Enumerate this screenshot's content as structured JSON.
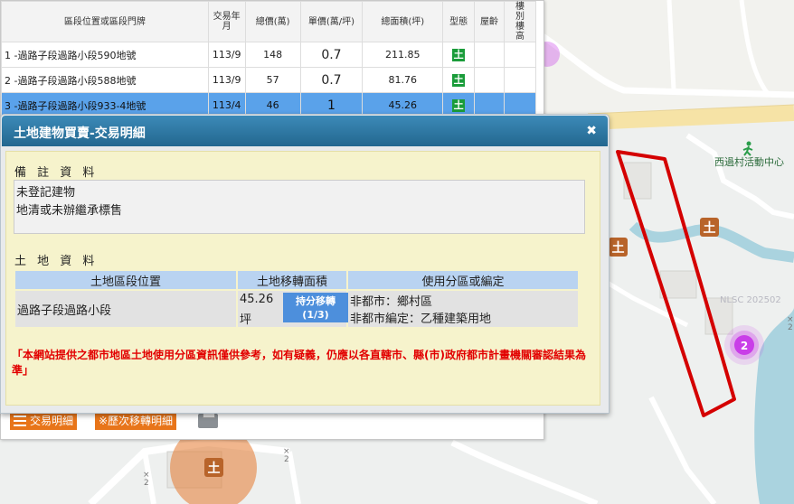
{
  "results": {
    "headers": [
      "區段位置或區段門牌",
      "交易年月",
      "總價(萬)",
      "單價(萬/坪)",
      "總面積(坪)",
      "型態",
      "屋齡",
      "樓別樓高"
    ],
    "rows": [
      {
        "address": "1 -過路子段過路小段590地號",
        "date": "113/9",
        "total": "148",
        "unit": "0.7",
        "area": "211.85",
        "type": "土",
        "age": "",
        "floor": ""
      },
      {
        "address": "2 -過路子段過路小段588地號",
        "date": "113/9",
        "total": "57",
        "unit": "0.7",
        "area": "81.76",
        "type": "土",
        "age": "",
        "floor": ""
      },
      {
        "address": "3 -過路子段過路小段933-4地號",
        "date": "113/4",
        "total": "46",
        "unit": "1",
        "area": "45.26",
        "type": "土",
        "age": "",
        "floor": ""
      }
    ],
    "detail_button": "交易明細",
    "history_button": "※歷次移轉明細",
    "print_icon": "printer-icon"
  },
  "dialog": {
    "title": "土地建物買賣-交易明細",
    "remarks_heading": "備 註 資 料",
    "remarks_lines": [
      "未登記建物",
      "地清或未辦繼承標售"
    ],
    "land_heading": "土 地 資 料",
    "land_headers": [
      "土地區段位置",
      "土地移轉面積",
      "使用分區或編定"
    ],
    "land_row": {
      "location": "過路子段過路小段",
      "area_value": "45.26",
      "area_unit": "坪",
      "share_label": "持分移轉",
      "share_fraction": "(1/3)",
      "zoning_line1": "非都市：鄉村區",
      "zoning_line2": "非都市編定：乙種建築用地"
    },
    "disclaimer": "「本網站提供之都市地區土地使用分區資訊僅供參考，如有疑義，仍應以各直轄市、縣(市)政府都市計畫機關審認結果為準」"
  },
  "map": {
    "place_label": "西過村活動中心",
    "watermark": "NLSC 202502",
    "cluster_count": "2",
    "marker_glyph": "土",
    "road_marks": [
      "×",
      "2"
    ],
    "colors": {
      "highlight": "#e00000",
      "cluster": "#c93ee8",
      "marker": "#b8642a",
      "water": "#aad3df",
      "road_yellow": "#f6e3a6"
    }
  }
}
